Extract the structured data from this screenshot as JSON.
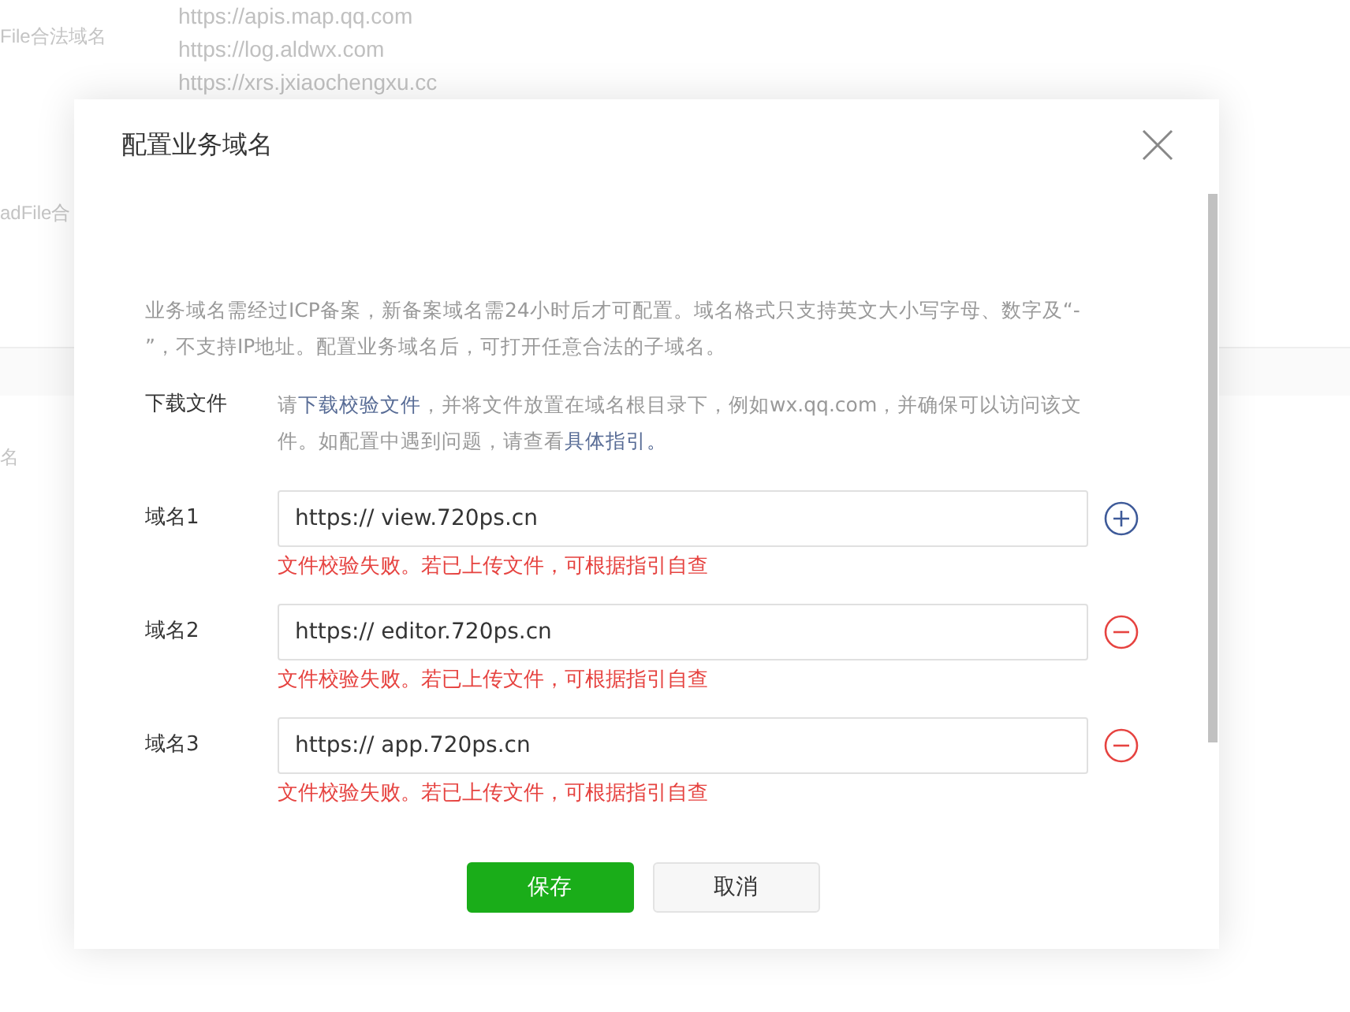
{
  "background": {
    "labels": [
      {
        "text": "File合法域名"
      },
      {
        "text": "adFile合"
      },
      {
        "text": "名"
      }
    ],
    "urls": [
      "https://apis.map.qq.com",
      "https://log.aldwx.com",
      "https://xrs.jxiaochengxu.cc"
    ]
  },
  "dialog": {
    "title": "配置业务域名",
    "description": "业务域名需经过ICP备案，新备案域名需24小时后才可配置。域名格式只支持英文大小写字母、数字及“- ”，不支持IP地址。配置业务域名后，可打开任意合法的子域名。",
    "download": {
      "label": "下载文件",
      "parts": [
        {
          "kind": "text",
          "text": "请"
        },
        {
          "kind": "link",
          "text": "下载校验文件"
        },
        {
          "kind": "text",
          "text": "，并将文件放置在域名根目录下，例如wx.qq.com，并确保可以访问该文件。如配置中遇到问题，请查看"
        },
        {
          "kind": "link",
          "text": "具体指引。"
        }
      ]
    },
    "domains": [
      {
        "label": "域名1",
        "value": "https:// view.720ps.cn",
        "error": "文件校验失败。若已上传文件，可根据指引自查",
        "kind": "add"
      },
      {
        "label": "域名2",
        "value": "https:// editor.720ps.cn",
        "error": "文件校验失败。若已上传文件，可根据指引自查",
        "kind": "remove"
      },
      {
        "label": "域名3",
        "value": "https:// app.720ps.cn",
        "error": "文件校验失败。若已上传文件，可根据指引自查",
        "kind": "remove"
      }
    ],
    "buttons": [
      {
        "label": "保存",
        "kind": "primary"
      },
      {
        "label": "取消",
        "kind": "default"
      }
    ]
  }
}
